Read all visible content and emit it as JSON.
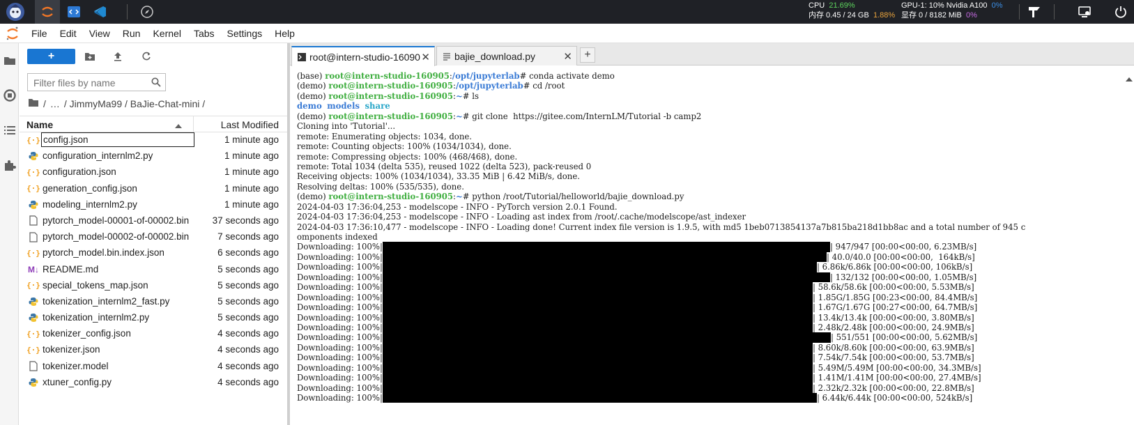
{
  "topbar": {
    "stats": {
      "cpu_label": "CPU",
      "cpu_value": "21.69%",
      "mem_label": "内存 0.45 / 24 GB",
      "mem_value": "1.88%",
      "gpu_label": "GPU-1: 10% Nvidia A100",
      "gpu_value": "0%",
      "vram_label": "显存 0 / 8182 MiB",
      "vram_value": "0%"
    }
  },
  "menubar": {
    "items": [
      "File",
      "Edit",
      "View",
      "Run",
      "Kernel",
      "Tabs",
      "Settings",
      "Help"
    ]
  },
  "filebrowser": {
    "new_button": "+",
    "search_placeholder": "Filter files by name",
    "breadcrumbs": [
      "/",
      "…",
      "/ JimmyMa99 / BaJie-Chat-mini /"
    ],
    "columns": {
      "name": "Name",
      "modified": "Last Modified"
    },
    "files": [
      {
        "name": "config.json",
        "type": "json",
        "modified": "1 minute ago"
      },
      {
        "name": "configuration_internlm2.py",
        "type": "py",
        "modified": "1 minute ago"
      },
      {
        "name": "configuration.json",
        "type": "json",
        "modified": "1 minute ago"
      },
      {
        "name": "generation_config.json",
        "type": "json",
        "modified": "1 minute ago"
      },
      {
        "name": "modeling_internlm2.py",
        "type": "py",
        "modified": "1 minute ago"
      },
      {
        "name": "pytorch_model-00001-of-00002.bin",
        "type": "file",
        "modified": "37 seconds ago"
      },
      {
        "name": "pytorch_model-00002-of-00002.bin",
        "type": "file",
        "modified": "7 seconds ago"
      },
      {
        "name": "pytorch_model.bin.index.json",
        "type": "json",
        "modified": "6 seconds ago"
      },
      {
        "name": "README.md",
        "type": "md",
        "modified": "5 seconds ago"
      },
      {
        "name": "special_tokens_map.json",
        "type": "json",
        "modified": "5 seconds ago"
      },
      {
        "name": "tokenization_internlm2_fast.py",
        "type": "py",
        "modified": "5 seconds ago"
      },
      {
        "name": "tokenization_internlm2.py",
        "type": "py",
        "modified": "5 seconds ago"
      },
      {
        "name": "tokenizer_config.json",
        "type": "json",
        "modified": "4 seconds ago"
      },
      {
        "name": "tokenizer.json",
        "type": "json",
        "modified": "4 seconds ago"
      },
      {
        "name": "tokenizer.model",
        "type": "file",
        "modified": "4 seconds ago"
      },
      {
        "name": "xtuner_config.py",
        "type": "py",
        "modified": "4 seconds ago"
      }
    ]
  },
  "tabs": [
    {
      "label": "root@intern-studio-16090",
      "active": true
    },
    {
      "label": "bajie_download.py",
      "active": false
    }
  ],
  "terminal": {
    "lines": [
      [
        [
          "t",
          "(base) "
        ],
        [
          "host",
          "root@intern-studio-160905"
        ],
        [
          "t",
          ":"
        ],
        [
          "path",
          "/opt/jupyterlab"
        ],
        [
          "t",
          "# conda activate demo"
        ]
      ],
      [
        [
          "t",
          "(demo) "
        ],
        [
          "host",
          "root@intern-studio-160905"
        ],
        [
          "t",
          ":"
        ],
        [
          "path",
          "/opt/jupyterlab"
        ],
        [
          "t",
          "# cd /root"
        ]
      ],
      [
        [
          "t",
          "(demo) "
        ],
        [
          "host",
          "root@intern-studio-160905"
        ],
        [
          "t",
          ":"
        ],
        [
          "path",
          "~"
        ],
        [
          "t",
          "# ls"
        ]
      ],
      [
        [
          "dir",
          "demo"
        ],
        [
          "t",
          "  "
        ],
        [
          "dir",
          "models"
        ],
        [
          "t",
          "  "
        ],
        [
          "dir2",
          "share"
        ]
      ],
      [
        [
          "t",
          "(demo) "
        ],
        [
          "host",
          "root@intern-studio-160905"
        ],
        [
          "t",
          ":"
        ],
        [
          "path",
          "~"
        ],
        [
          "t",
          "# git clone  https://gitee.com/InternLM/Tutorial -b camp2"
        ]
      ],
      [
        [
          "t",
          "Cloning into 'Tutorial'..."
        ]
      ],
      [
        [
          "t",
          "remote: Enumerating objects: 1034, done."
        ]
      ],
      [
        [
          "t",
          "remote: Counting objects: 100% (1034/1034), done."
        ]
      ],
      [
        [
          "t",
          "remote: Compressing objects: 100% (468/468), done."
        ]
      ],
      [
        [
          "t",
          "remote: Total 1034 (delta 535), reused 1022 (delta 523), pack-reused 0"
        ]
      ],
      [
        [
          "t",
          "Receiving objects: 100% (1034/1034), 33.35 MiB | 6.42 MiB/s, done."
        ]
      ],
      [
        [
          "t",
          "Resolving deltas: 100% (535/535), done."
        ]
      ],
      [
        [
          "t",
          "(demo) "
        ],
        [
          "host",
          "root@intern-studio-160905"
        ],
        [
          "t",
          ":"
        ],
        [
          "path",
          "~"
        ],
        [
          "t",
          "# python /root/Tutorial/helloworld/bajie_download.py"
        ]
      ],
      [
        [
          "t",
          "2024-04-03 17:36:04,253 - modelscope - INFO - PyTorch version 2.0.1 Found."
        ]
      ],
      [
        [
          "t",
          "2024-04-03 17:36:04,253 - modelscope - INFO - Loading ast index from /root/.cache/modelscope/ast_indexer"
        ]
      ],
      [
        [
          "t",
          "2024-04-03 17:36:10,477 - modelscope - INFO - Loading done! Current index file version is 1.9.5, with md5 1beb0713854137a7b815ba218d1bb8ac and a total number of 945 c"
        ]
      ],
      [
        [
          "t",
          "omponents indexed"
        ]
      ]
    ],
    "download_prefix": "Downloading: 100%|",
    "downloads": [
      {
        "tail": "| 947/947 [00:00<00:00, 6.23MB/s]",
        "bar_end": 775
      },
      {
        "tail": "| 40.0/40.0 [00:00<00:00,  164kB/s]",
        "bar_end": 770
      },
      {
        "tail": "| 6.86k/6.86k [00:00<00:00, 106kB/s]",
        "bar_end": 756
      },
      {
        "tail": "| 132/132 [00:00<00:00, 1.05MB/s]",
        "bar_end": 775
      },
      {
        "tail": "| 58.6k/58.6k [00:00<00:00, 5.53MB/s]",
        "bar_end": 750
      },
      {
        "tail": "| 1.85G/1.85G [00:23<00:00, 84.4MB/s]",
        "bar_end": 750
      },
      {
        "tail": "| 1.67G/1.67G [00:27<00:00, 64.7MB/s]",
        "bar_end": 750
      },
      {
        "tail": "| 13.4k/13.4k [00:00<00:00, 3.80MB/s]",
        "bar_end": 750
      },
      {
        "tail": "| 2.48k/2.48k [00:00<00:00, 24.9MB/s]",
        "bar_end": 750
      },
      {
        "tail": "| 551/551 [00:00<00:00, 5.62MB/s]",
        "bar_end": 776
      },
      {
        "tail": "| 8.60k/8.60k [00:00<00:00, 63.9MB/s]",
        "bar_end": 750
      },
      {
        "tail": "| 7.54k/7.54k [00:00<00:00, 53.7MB/s]",
        "bar_end": 750
      },
      {
        "tail": "| 5.49M/5.49M [00:00<00:00, 34.3MB/s]",
        "bar_end": 750
      },
      {
        "tail": "| 1.41M/1.41M [00:00<00:00, 27.4MB/s]",
        "bar_end": 750
      },
      {
        "tail": "| 2.32k/2.32k [00:00<00:00, 22.8MB/s]",
        "bar_end": 750
      },
      {
        "tail": "| 6.44k/6.44k [00:00<00:00, 524kB/s]",
        "bar_end": 756
      }
    ]
  },
  "colors": {
    "accent": "#1976d2",
    "topbar_bg": "#1f2126",
    "prompt_host": "#3fae3f",
    "prompt_path": "#3a7bd5"
  },
  "icons": [
    "jupyter-logo-icon",
    "vscode-icon",
    "compass-icon",
    "folder-icon",
    "running-icon",
    "toc-icon",
    "extension-icon",
    "upload-icon",
    "refresh-icon",
    "search-icon",
    "terminal-icon",
    "python-icon",
    "json-icon",
    "markdown-icon",
    "file-icon"
  ]
}
